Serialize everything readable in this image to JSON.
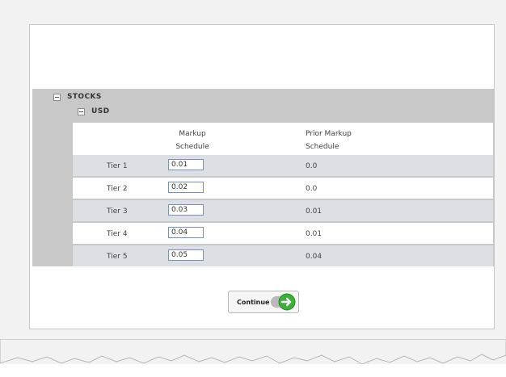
{
  "sections": {
    "stocks_label": "STOCKS",
    "usd_label": "USD"
  },
  "table": {
    "headers": {
      "markup_line1": "Markup",
      "markup_line2": "Schedule",
      "prior_line1": "Prior Markup",
      "prior_line2": "Schedule"
    },
    "rows": [
      {
        "label": "Tier 1",
        "markup": "0.01",
        "prior": "0.0"
      },
      {
        "label": "Tier 2",
        "markup": "0.02",
        "prior": "0.0"
      },
      {
        "label": "Tier 3",
        "markup": "0.03",
        "prior": "0.01"
      },
      {
        "label": "Tier 4",
        "markup": "0.04",
        "prior": "0.01"
      },
      {
        "label": "Tier 5",
        "markup": "0.05",
        "prior": "0.04"
      }
    ]
  },
  "actions": {
    "continue_label": "Continue"
  },
  "colors": {
    "row_alt": "#dcdfe3",
    "arrow_green": "#3fae3a"
  }
}
